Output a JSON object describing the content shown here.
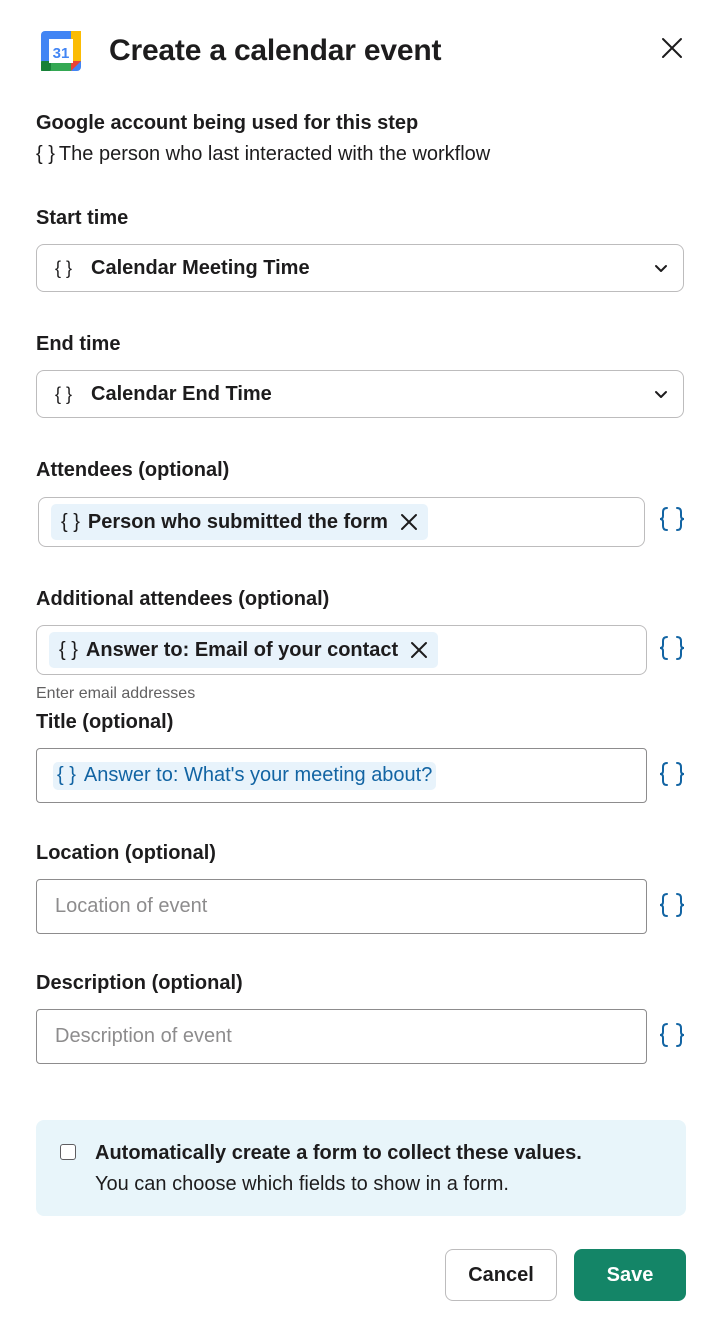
{
  "header": {
    "logo_number": "31",
    "logo_icon": "google-calendar-icon",
    "title": "Create a calendar event",
    "close_icon": "close-icon"
  },
  "account": {
    "label": "Google account being used for this step",
    "value": "The person who last interacted with the workflow",
    "braces": "{ }"
  },
  "start_time": {
    "label": "Start time",
    "value": "Calendar Meeting Time",
    "braces": "{ }"
  },
  "end_time": {
    "label": "End time",
    "value": "Calendar End Time",
    "braces": "{ }"
  },
  "attendees": {
    "label": "Attendees (optional)",
    "chip": "Person who submitted the form",
    "braces": "{ }"
  },
  "additional_attendees": {
    "label": "Additional attendees (optional)",
    "chip": "Answer to: Email of your contact",
    "braces": "{ }",
    "help": "Enter email addresses"
  },
  "title_field": {
    "label": "Title (optional)",
    "chip": "Answer to: What's your meeting about?",
    "braces": "{ }"
  },
  "location": {
    "label": "Location (optional)",
    "placeholder": "Location of event"
  },
  "description": {
    "label": "Description (optional)",
    "placeholder": "Description of event"
  },
  "auto_form": {
    "title": "Automatically create a form to collect these values.",
    "subtitle": "You can choose which fields to show in a form."
  },
  "buttons": {
    "cancel": "Cancel",
    "save": "Save"
  },
  "colors": {
    "accent_blue": "#1264a3",
    "save_green": "#148567",
    "chip_bg": "#e8f3fb",
    "info_bg": "#e8f5fa"
  }
}
